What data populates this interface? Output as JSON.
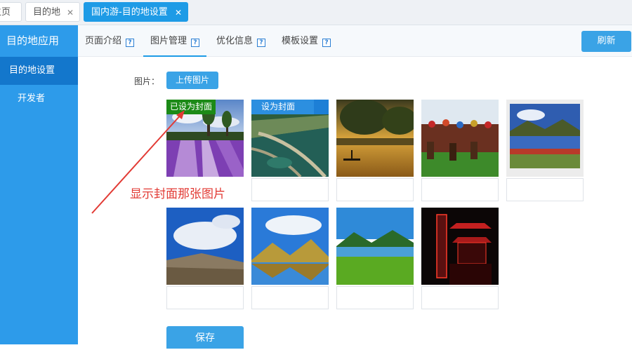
{
  "top_tabs": [
    {
      "label": "主页",
      "closable": false
    },
    {
      "label": "目的地",
      "closable": true,
      "close_glyph": "✕"
    },
    {
      "label": "国内游-目的地设置",
      "closable": true,
      "close_glyph": "✕",
      "active": true
    }
  ],
  "sidebar": {
    "title": "目的地应用",
    "items": [
      {
        "label": "目的地设置",
        "active": true
      },
      {
        "label": "开发者"
      }
    ]
  },
  "page_tabs": [
    {
      "label": "页面介绍",
      "help": "?"
    },
    {
      "label": "图片管理",
      "help": "?",
      "active": true
    },
    {
      "label": "优化信息",
      "help": "?"
    },
    {
      "label": "模板设置",
      "help": "?"
    }
  ],
  "refresh_label": "刷新",
  "image_label": "图片：",
  "upload_label": "上传图片",
  "cover_badge": "已设为封面",
  "set_cover_label": "设为封面",
  "annotation": "显示封面那张图片",
  "save_label": "保存",
  "images": [
    {
      "subject": "lavender field",
      "is_cover": true
    },
    {
      "subject": "lake with wooden pier",
      "hover": true
    },
    {
      "subject": "boat on golden lake"
    },
    {
      "subject": "horse riders on grassland"
    },
    {
      "subject": "mountain lake reflection"
    },
    {
      "subject": "blue sky over rocky hill"
    },
    {
      "subject": "mountains reflected in lake"
    },
    {
      "subject": "green lake valley"
    },
    {
      "subject": "red-lit pagoda at night"
    }
  ],
  "colors": {
    "accent": "#1e9be6",
    "sidebar": "#2d9bea",
    "sidebar_active": "#1377cc",
    "cover_badge": "#1c8a17",
    "annotation": "#e23a34"
  }
}
